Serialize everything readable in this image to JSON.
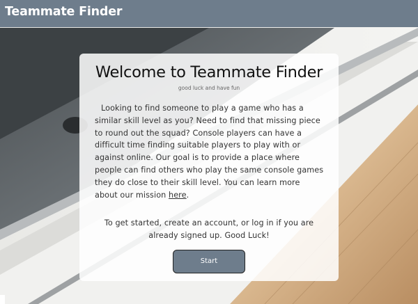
{
  "navbar": {
    "brand": "Teammate Finder"
  },
  "hero": {
    "title": "Welcome to Teammate Finder",
    "subtitle": "good luck and have fun",
    "body_text": "Looking to find someone to play a game who has a similar skill level as you? Need to find that missing piece to round out the squad? Console players can have a difficult time finding suitable players to play with or against online. Our goal is to provide a place where people can find others who play the same console games they do close to their skill level. You can learn more about our mission ",
    "mission_link": "here",
    "body_end": ".",
    "cta_text": "To get started, create an account, or log in if you are already signed up. Good Luck!",
    "start_button": "Start"
  },
  "colors": {
    "navbar": "#6e7d8c",
    "button": "#6e7d8c",
    "card": "#ffffff"
  }
}
